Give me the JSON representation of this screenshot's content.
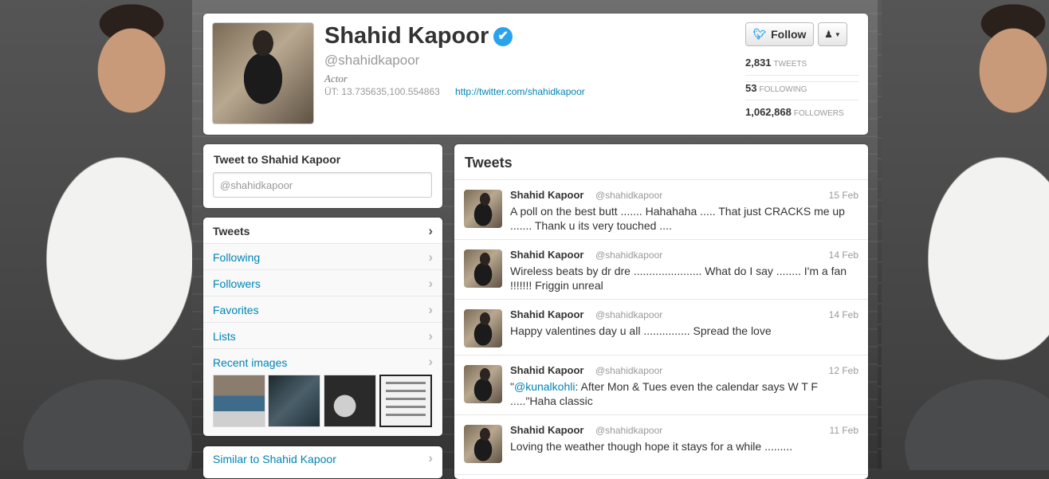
{
  "profile": {
    "name": "Shahid Kapoor",
    "verified_icon": "✔",
    "handle": "@shahidkapoor",
    "bio": "Actor",
    "location": "ÜT: 13.735635,100.554863",
    "url": "http://twitter.com/shahidkapoor",
    "follow_label": "Follow",
    "stats": {
      "tweets": {
        "value": "2,831",
        "label": "TWEETS"
      },
      "following": {
        "value": "53",
        "label": "FOLLOWING"
      },
      "followers": {
        "value": "1,062,868",
        "label": "FOLLOWERS"
      }
    }
  },
  "tweet_to": {
    "title": "Tweet to Shahid Kapoor",
    "placeholder": "@shahidkapoor"
  },
  "nav": {
    "items": [
      {
        "label": "Tweets"
      },
      {
        "label": "Following"
      },
      {
        "label": "Followers"
      },
      {
        "label": "Favorites"
      },
      {
        "label": "Lists"
      }
    ],
    "recent_images": "Recent images",
    "similar": "Similar to Shahid Kapoor",
    "chevron": "›"
  },
  "stream": {
    "title": "Tweets",
    "tweets": [
      {
        "name": "Shahid Kapoor",
        "handle": "@shahidkapoor",
        "date": "15 Feb",
        "text": "A poll on the best butt ....... Hahahaha ..... That just CRACKS me up ....... Thank u its very touched ...."
      },
      {
        "name": "Shahid Kapoor",
        "handle": "@shahidkapoor",
        "date": "14 Feb",
        "text": "Wireless beats by dr dre ...................... What do I say ........ I'm a fan !!!!!!! Friggin unreal"
      },
      {
        "name": "Shahid Kapoor",
        "handle": "@shahidkapoor",
        "date": "14 Feb",
        "text": "Happy valentines day u all ............... Spread the love"
      },
      {
        "name": "Shahid Kapoor",
        "handle": "@shahidkapoor",
        "date": "12 Feb",
        "text_prefix": "\"",
        "mention": "@kunalkohli",
        "text": ": After Mon & Tues even the calendar says W T F .....\"Haha classic"
      },
      {
        "name": "Shahid Kapoor",
        "handle": "@shahidkapoor",
        "date": "11 Feb",
        "text": "Loving the weather though hope it stays for a while ........."
      }
    ]
  },
  "colors": {
    "link": "#0084b4",
    "verified": "#2aa3ef"
  }
}
